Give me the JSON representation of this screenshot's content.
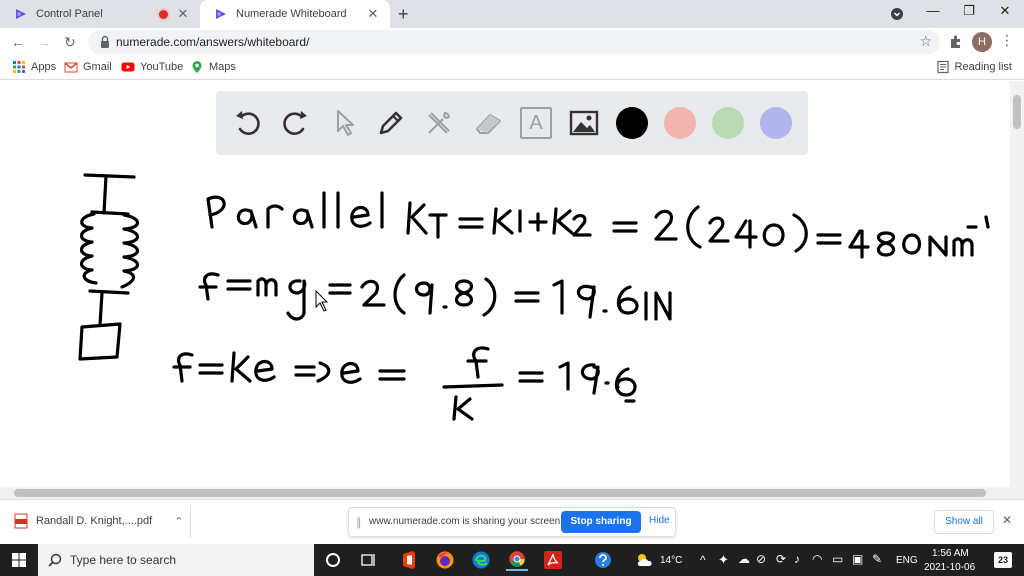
{
  "browser": {
    "tabs": [
      {
        "title": "Control Panel",
        "recording": true
      },
      {
        "title": "Numerade Whiteboard"
      }
    ],
    "new_tab": "+",
    "window_controls": {
      "minimize": "—",
      "restore": "❐",
      "close": "✕"
    },
    "address": "numerade.com/answers/whiteboard/",
    "profile_initial": "H"
  },
  "bookmarks": {
    "items": [
      "Apps",
      "Gmail",
      "YouTube",
      "Maps"
    ],
    "reading_list": "Reading list"
  },
  "whiteboard": {
    "tools": [
      "undo",
      "redo",
      "select",
      "pen",
      "tools",
      "eraser",
      "text",
      "image"
    ],
    "text_tool_glyph": "A",
    "colors": [
      "#000000",
      "#f4b4b0",
      "#b8dbb4",
      "#b3b6ee"
    ],
    "selected_color": "#000000",
    "handwriting": [
      "Parallel  KT = K1+K2 = 2(240) = 480Nm⁻¹",
      "f = mg = 2(9.8) = 19.6 N",
      "f = ke => e = f/k = 19.6/"
    ]
  },
  "downloads": {
    "file_name": "Randall D. Knight,....pdf",
    "share_message": "www.numerade.com is sharing your screen.",
    "stop_label": "Stop sharing",
    "hide_label": "Hide",
    "show_all_label": "Show all"
  },
  "taskbar": {
    "search_placeholder": "Type here to search",
    "weather": "14°C",
    "language": "ENG",
    "time": "1:56 AM",
    "date": "2021-10-06",
    "notification_count": "23"
  }
}
